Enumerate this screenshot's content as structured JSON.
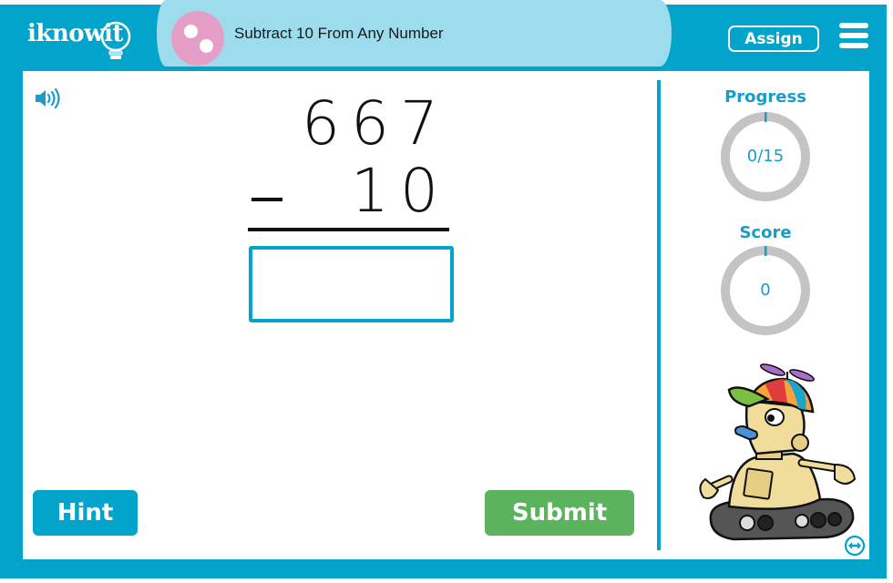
{
  "header": {
    "logo_text": "iknowit",
    "title": "Subtract 10 From Any Number",
    "assign_label": "Assign",
    "menu_icon": "hamburger-menu-icon",
    "topic_icon": "pink-dots-icon"
  },
  "problem": {
    "minuend": "667",
    "subtrahend": "10",
    "operator": "minus",
    "answer_value": "",
    "answer_placeholder": ""
  },
  "controls": {
    "sound_icon": "speaker-icon",
    "hint_label": "Hint",
    "submit_label": "Submit",
    "expand_icon": "horizontal-arrows-icon"
  },
  "sidebar": {
    "progress": {
      "label": "Progress",
      "value_text": "0/15",
      "current": 0,
      "total": 15
    },
    "score": {
      "label": "Score",
      "value_text": "0",
      "current": 0
    },
    "mascot": "robot-mascot"
  },
  "colors": {
    "frame": "#03a4cb",
    "title_pill": "#9ddcec",
    "topic_icon": "#e59fc6",
    "accent_text": "#1a9cc9",
    "submit": "#5cb35e",
    "ring_track": "#c4c4c4"
  }
}
